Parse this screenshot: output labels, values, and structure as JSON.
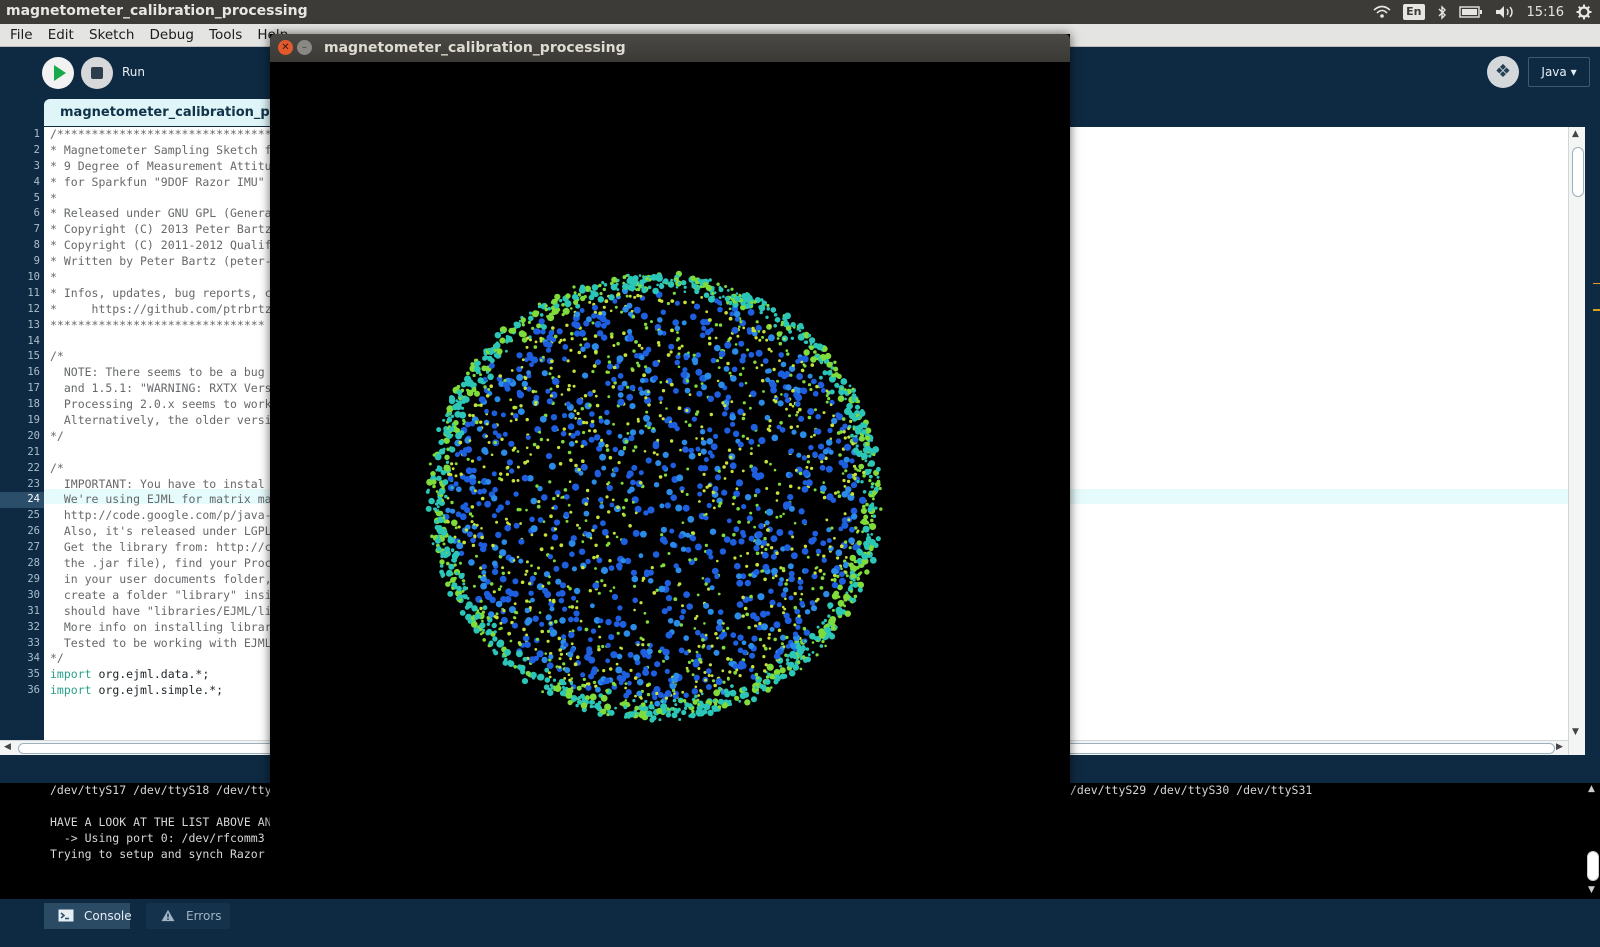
{
  "top_panel": {
    "title": "magnetometer_calibration_processing",
    "keyboard": "En",
    "clock": "15:16"
  },
  "menu": [
    "File",
    "Edit",
    "Sketch",
    "Debug",
    "Tools",
    "Help"
  ],
  "toolbar": {
    "run_label": "Run",
    "mode": "Java ▾"
  },
  "tab": {
    "label": "magnetometer_calibration_processing"
  },
  "editor": {
    "line_numbers": [
      "1",
      "2",
      "3",
      "4",
      "5",
      "6",
      "7",
      "8",
      "9",
      "10",
      "11",
      "12",
      "13",
      "14",
      "15",
      "16",
      "17",
      "18",
      "19",
      "20",
      "21",
      "22",
      "23",
      "24",
      "25",
      "26",
      "27",
      "28",
      "29",
      "30",
      "31",
      "32",
      "33",
      "34",
      "35",
      "36"
    ],
    "current_line": "24",
    "lines": [
      "/*******************************",
      "* Magnetometer Sampling Sketch f",
      "* 9 Degree of Measurement Attitu",
      "* for Sparkfun \"9DOF Razor IMU\" ",
      "*",
      "* Released under GNU GPL (Genera",
      "* Copyright (C) 2013 Peter Bartz",
      "* Copyright (C) 2011-2012 Qualif",
      "* Written by Peter Bartz (peter-",
      "*",
      "* Infos, updates, bug reports, c",
      "*     https://github.com/ptrbrtz",
      "*******************************",
      "",
      "/*",
      "  NOTE: There seems to be a bug ",
      "  and 1.5.1: \"WARNING: RXTX Vers",
      "  Processing 2.0.x seems to work",
      "  Alternatively, the older versi",
      "*/",
      "",
      "/*",
      "  IMPORTANT: You have to instal",
      "  We're using EJML for matrix ma",
      "  http://code.google.com/p/java-",
      "  Also, it's released under LGPL",
      "  Get the library from: http://c",
      "  the .jar file), find your Proc",
      "  in your user documents folder,",
      "  create a folder \"library\" insi",
      "  should have \"libraries/EJML/li",
      "  More info on installing librar",
      "  Tested to be working with EJML",
      "*/"
    ],
    "imports": [
      {
        "keyword": "import",
        "rest": " org.ejml.data.*;"
      },
      {
        "keyword": "import",
        "rest": " org.ejml.simple.*;"
      }
    ]
  },
  "console": {
    "lines": [
      "/dev/ttyS17 /dev/ttyS18 /dev/tty",
      "",
      "HAVE A LOOK AT THE LIST ABOVE AN",
      "  -> Using port 0: /dev/rfcomm3",
      "Trying to setup and synch Razor"
    ],
    "right_text": "/dev/ttyS29 /dev/ttyS30 /dev/ttyS31"
  },
  "bottom_tabs": {
    "console": "Console",
    "errors": "Errors"
  },
  "sketch_window": {
    "title": "magnetometer_calibration_processing",
    "background": "#000000",
    "point_colors": [
      "#1e5fe0",
      "#2a8ce8",
      "#2bc6b8",
      "#7fdc3a",
      "#c7e23a"
    ]
  }
}
